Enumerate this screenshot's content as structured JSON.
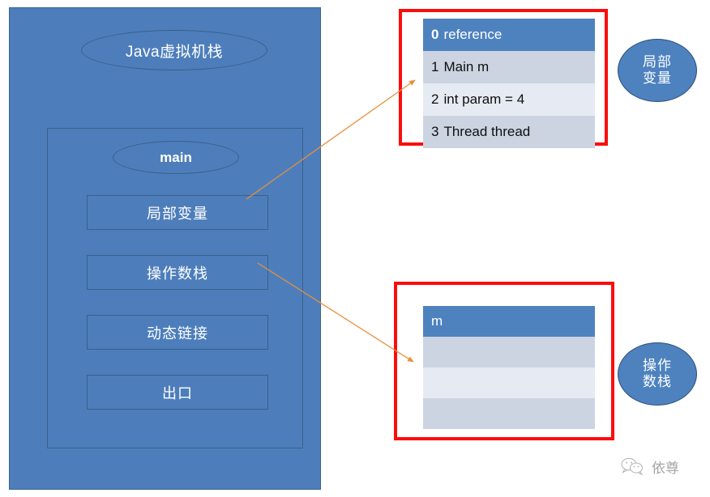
{
  "diagram": {
    "title": "Java虚拟机栈",
    "frame": {
      "name": "main",
      "slots": [
        {
          "label": "局部变量"
        },
        {
          "label": "操作数栈"
        },
        {
          "label": "动态链接"
        },
        {
          "label": "出口"
        }
      ]
    }
  },
  "local_variable_table": {
    "header": {
      "index": "0",
      "text": "reference"
    },
    "rows": [
      {
        "index": "1",
        "text": "Main m"
      },
      {
        "index": "2",
        "text": "int param = 4"
      },
      {
        "index": "3",
        "text": "Thread thread"
      }
    ]
  },
  "operand_stack_table": {
    "header": {
      "text": "m"
    },
    "rows": [
      {
        "text": ""
      },
      {
        "text": ""
      },
      {
        "text": ""
      }
    ]
  },
  "callouts": {
    "local_variable": {
      "line1": "局部",
      "line2": "变量"
    },
    "operand_stack": {
      "line1": "操作",
      "line2": "数栈"
    }
  },
  "watermark": {
    "text": "依尊"
  },
  "colors": {
    "panel_fill": "#4d7ebb",
    "panel_stroke": "#3a5f8a",
    "table_header": "#4d82bf",
    "table_band_a": "#ccd4e2",
    "table_band_b": "#e6eaf2",
    "highlight_border": "#fc0d0d",
    "arrow": "#e8903a"
  }
}
